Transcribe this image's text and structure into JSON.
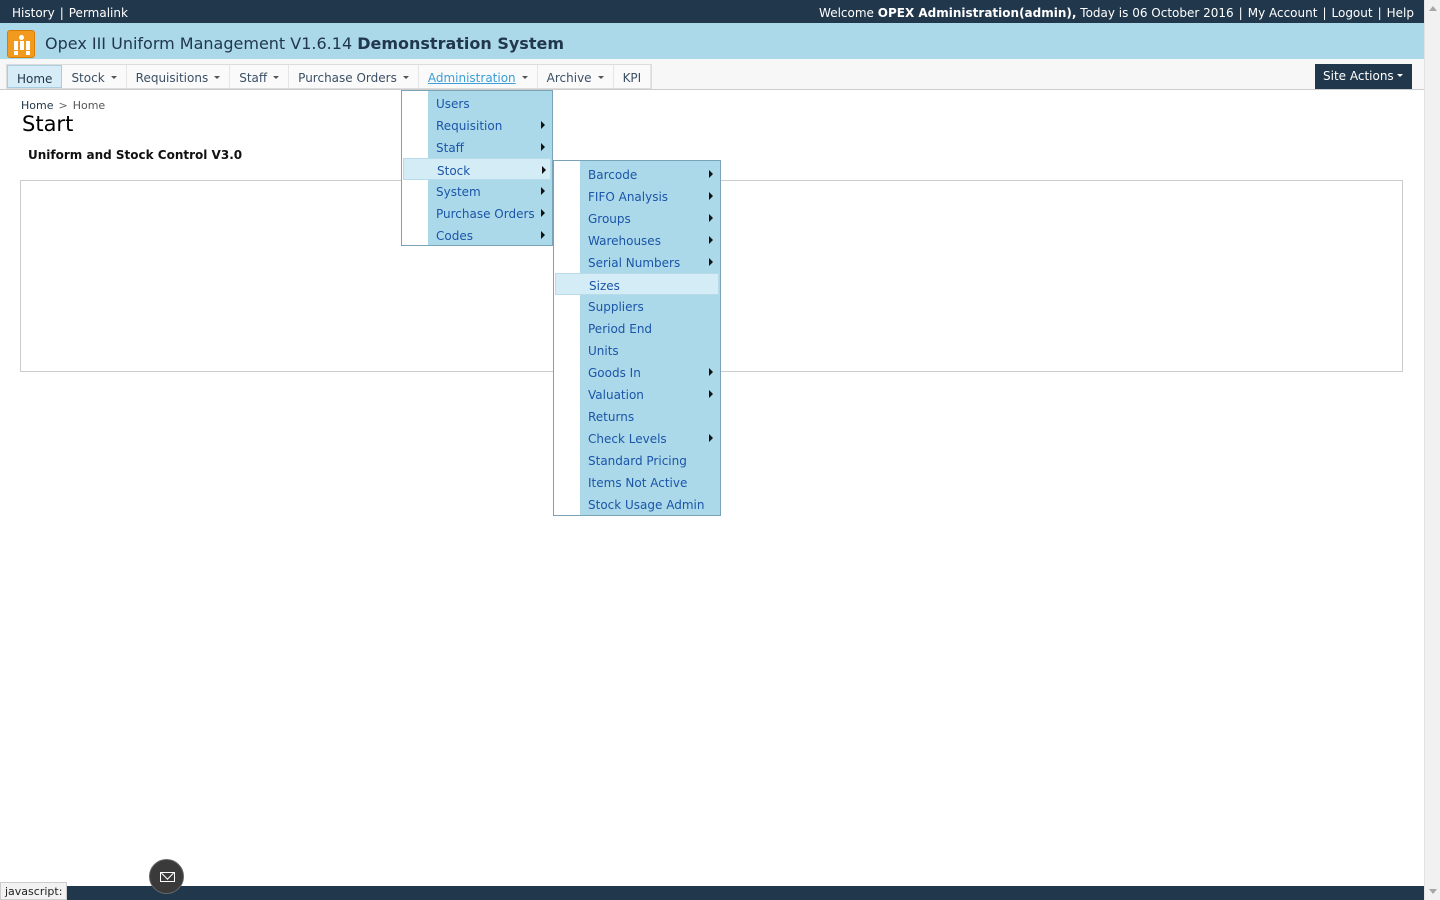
{
  "topbar": {
    "history": "History",
    "permalink": "Permalink",
    "welcome_prefix": "Welcome",
    "user": "OPEX Administration(admin),",
    "today": "Today is 06 October 2016",
    "my_account": "My Account",
    "logout": "Logout",
    "help": "Help"
  },
  "site": {
    "title_regular": "Opex III Uniform Management V1.6.14",
    "title_bold": "Demonstration System"
  },
  "nav": {
    "home": "Home",
    "stock": "Stock",
    "requisitions": "Requisitions",
    "staff": "Staff",
    "purchase_orders": "Purchase Orders",
    "administration": "Administration",
    "archive": "Archive",
    "kpi": "KPI",
    "site_actions": "Site Actions"
  },
  "breadcrumb": {
    "root": "Home",
    "sep": ">",
    "current": "Home"
  },
  "page": {
    "title": "Start",
    "subtitle": "Uniform and Stock Control V3.0"
  },
  "admin_menu": {
    "items": [
      "Users",
      "Requisition",
      "Staff",
      "Stock",
      "System",
      "Purchase Orders",
      "Codes"
    ],
    "highlighted": "Stock"
  },
  "stock_menu": {
    "items": [
      "Barcode",
      "FIFO Analysis",
      "Groups",
      "Warehouses",
      "Serial Numbers",
      "Sizes",
      "Suppliers",
      "Period End",
      "Units",
      "Goods In",
      "Valuation",
      "Returns",
      "Check Levels",
      "Standard Pricing",
      "Items Not Active",
      "Stock Usage Admin"
    ],
    "highlighted": "Sizes"
  },
  "status_bar": {
    "text": "javascript:"
  },
  "colors": {
    "dark_bar": "#21374c",
    "title_bar": "#acd9ea",
    "menu_bg": "#acd9ea",
    "link": "#1a55a8",
    "logo": "#f29a1e"
  }
}
